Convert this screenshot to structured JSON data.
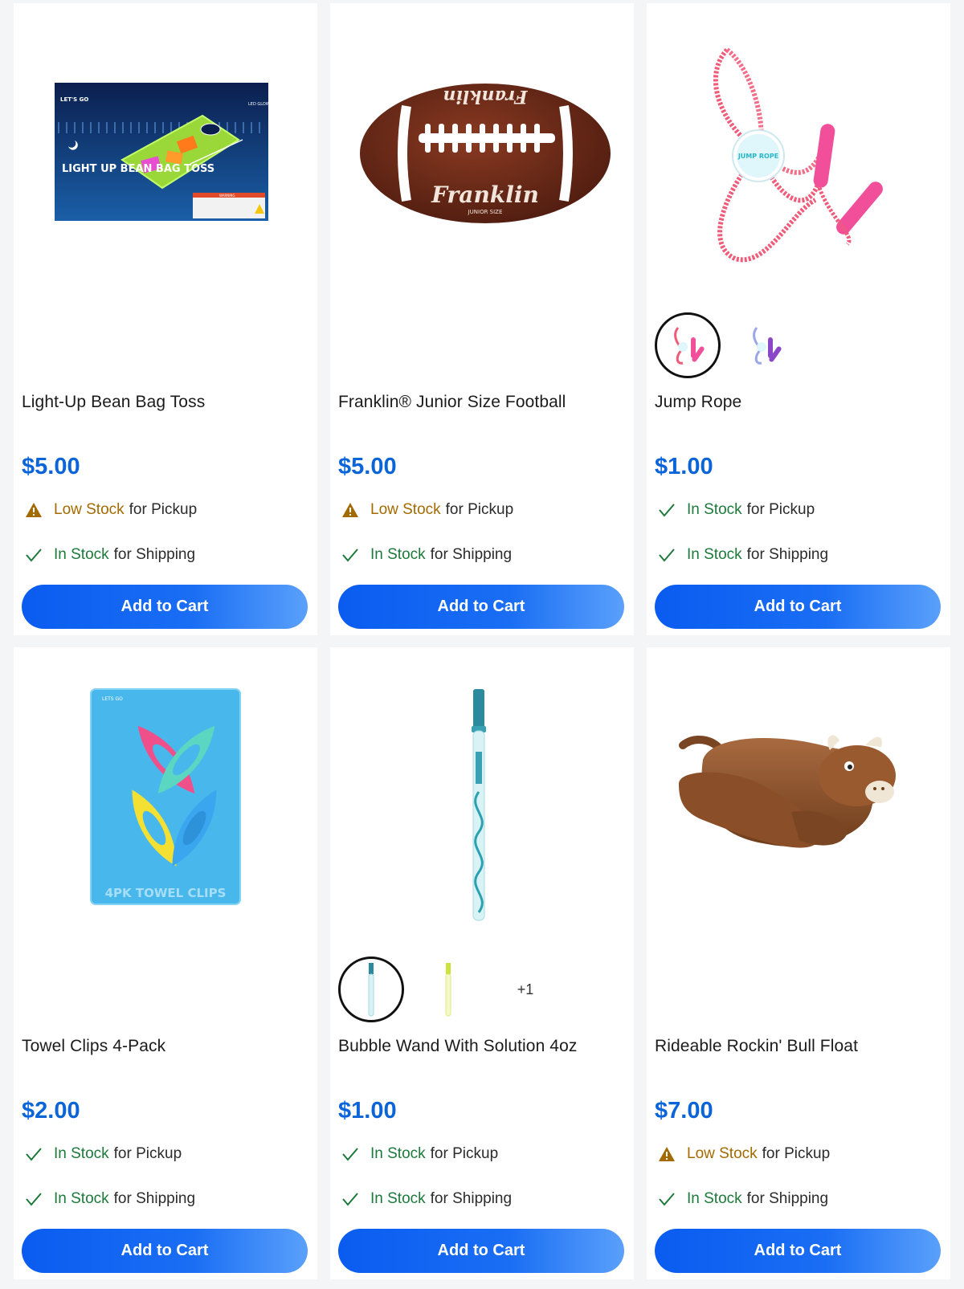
{
  "products": [
    {
      "title": "Light-Up Bean Bag Toss",
      "price": "$5.00",
      "pickup": {
        "status": "Low Stock",
        "suffix": "for Pickup",
        "level": "low"
      },
      "shipping": {
        "status": "In Stock",
        "suffix": "for Shipping",
        "level": "in"
      },
      "button": "Add to Cart",
      "image_icon": "bean-bag-toss-box-image",
      "box_text": {
        "brand": "LET'S GO",
        "badge": "LED GLOW",
        "headline": "LIGHT UP BEAN BAG TOSS",
        "warning": "WARNING"
      }
    },
    {
      "title": "Franklin® Junior Size Football",
      "price": "$5.00",
      "pickup": {
        "status": "Low Stock",
        "suffix": "for Pickup",
        "level": "low"
      },
      "shipping": {
        "status": "In Stock",
        "suffix": "for Shipping",
        "level": "in"
      },
      "button": "Add to Cart",
      "image_icon": "football-image",
      "ball_text": {
        "brand": "Franklin",
        "size": "JUNIOR SIZE"
      }
    },
    {
      "title": "Jump Rope",
      "price": "$1.00",
      "pickup": {
        "status": "In Stock",
        "suffix": "for Pickup",
        "level": "in"
      },
      "shipping": {
        "status": "In Stock",
        "suffix": "for Shipping",
        "level": "in"
      },
      "button": "Add to Cart",
      "image_icon": "jump-rope-image",
      "tag_text": "JUMP ROPE",
      "swatches": [
        "pink-jump-rope-swatch",
        "purple-jump-rope-swatch"
      ],
      "swatch_more": ""
    },
    {
      "title": "Towel Clips 4-Pack",
      "price": "$2.00",
      "pickup": {
        "status": "In Stock",
        "suffix": "for Pickup",
        "level": "in"
      },
      "shipping": {
        "status": "In Stock",
        "suffix": "for Shipping",
        "level": "in"
      },
      "button": "Add to Cart",
      "image_icon": "towel-clips-pack-image",
      "pack_text": "4PK TOWEL CLIPS"
    },
    {
      "title": "Bubble Wand With Solution 4oz",
      "price": "$1.00",
      "pickup": {
        "status": "In Stock",
        "suffix": "for Pickup",
        "level": "in"
      },
      "shipping": {
        "status": "In Stock",
        "suffix": "for Shipping",
        "level": "in"
      },
      "button": "Add to Cart",
      "image_icon": "bubble-wand-image",
      "swatches": [
        "blue-bubble-wand-swatch",
        "yellow-bubble-wand-swatch"
      ],
      "swatch_more": "+1"
    },
    {
      "title": "Rideable Rockin' Bull Float",
      "price": "$7.00",
      "pickup": {
        "status": "Low Stock",
        "suffix": "for Pickup",
        "level": "low"
      },
      "shipping": {
        "status": "In Stock",
        "suffix": "for Shipping",
        "level": "in"
      },
      "button": "Add to Cart",
      "image_icon": "bull-float-image"
    }
  ],
  "colors": {
    "price": "#0b64d8",
    "in_stock": "#1c7a3a",
    "low_stock": "#a36a00",
    "button": "#0a5cf0"
  }
}
